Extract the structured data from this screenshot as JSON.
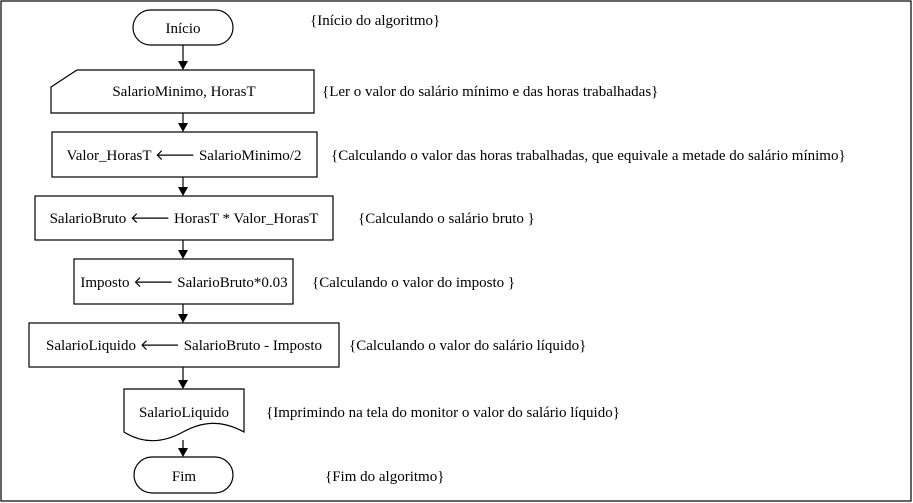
{
  "flowchart": {
    "start": {
      "label": "Início",
      "comment": "{Início do algoritmo}"
    },
    "input": {
      "label": "SalarioMinimo, HorasT",
      "comment": "{Ler o valor do salário mínimo e das horas trabalhadas}"
    },
    "step_valor": {
      "label": "Valor_HorasT 🡐 SalarioMinimo/2",
      "comment": "{Calculando o valor das horas trabalhadas, que equivale a metade do salário mínimo}"
    },
    "step_bruto": {
      "label": "SalarioBruto 🡐 HorasT * Valor_HorasT",
      "comment": "{Calculando o salário bruto }"
    },
    "step_imposto": {
      "label": "Imposto 🡐 SalarioBruto*0.03",
      "comment": "{Calculando o valor do imposto }"
    },
    "step_liquido": {
      "label": "SalarioLiquido 🡐 SalarioBruto - Imposto",
      "comment": "{Calculando o valor do salário líquido}"
    },
    "output": {
      "label": "SalarioLiquido",
      "comment": "{Imprimindo na tela do monitor o valor do salário líquido}"
    },
    "end": {
      "label": "Fim",
      "comment": "{Fim do algoritmo}"
    }
  }
}
